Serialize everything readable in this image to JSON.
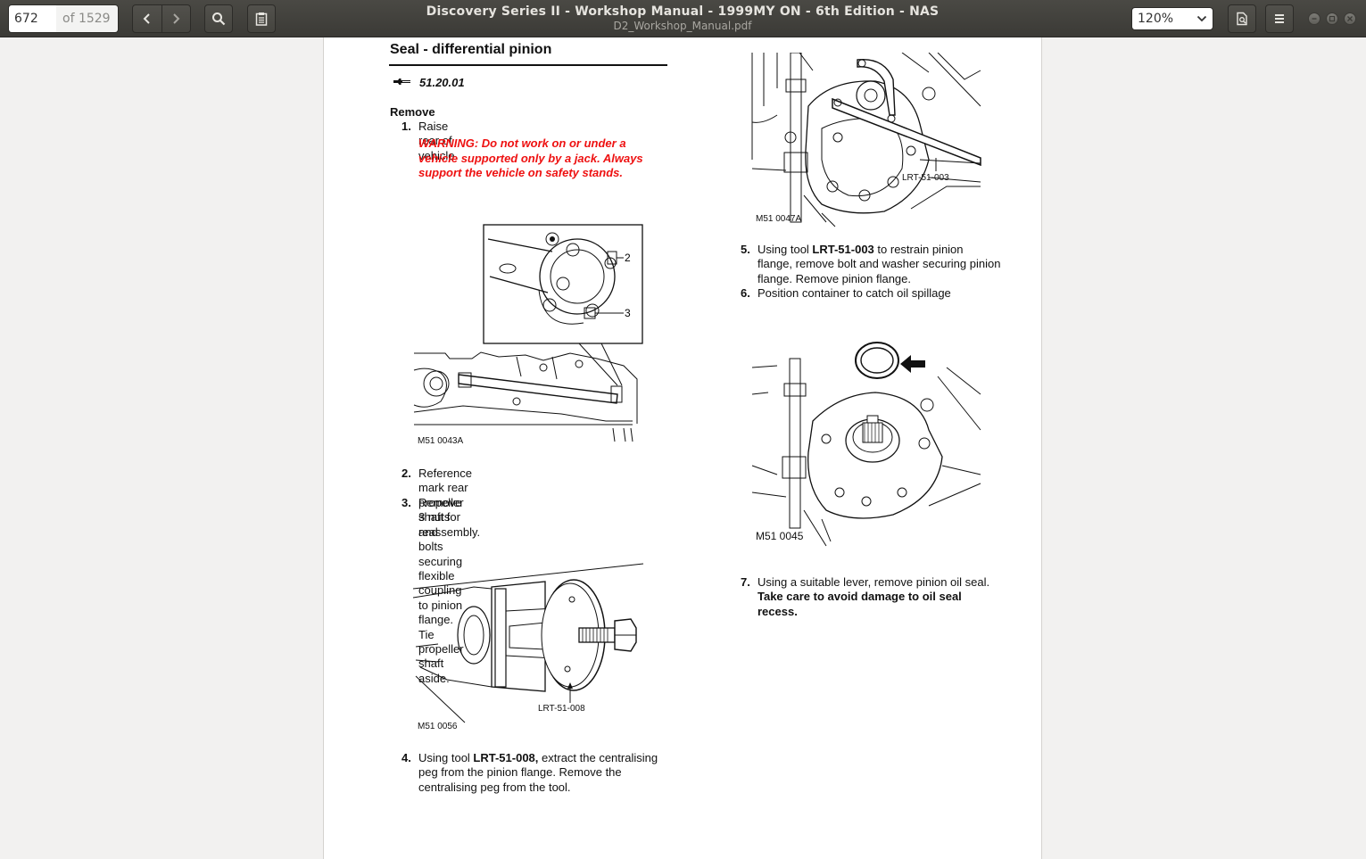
{
  "toolbar": {
    "page_number": "672",
    "page_total": "of 1529",
    "title": "Discovery Series II - Workshop Manual - 1999MY ON - 6th Edition - NAS",
    "filename": "D2_Workshop_Manual.pdf",
    "zoom": "120%",
    "icons": [
      "chevron-left-icon",
      "chevron-right-icon",
      "search-icon",
      "clipboard-icon",
      "document-properties-icon",
      "menu-icon",
      "minimize-icon",
      "maximize-icon",
      "close-icon"
    ]
  },
  "doc": {
    "section_title": "Seal - differential pinion",
    "op_code": "51.20.01",
    "heading_remove": "Remove",
    "step1_num": "1.",
    "step1_text": "Raise rear of vehicle.",
    "warning_lines": [
      "WARNING: Do not work on or under a",
      "vehicle supported only by a jack. Always",
      "support the vehicle on safety stands."
    ],
    "fig1_callout_2": "2",
    "fig1_callout_3": "3",
    "fig1_code": "M51 0043A",
    "step2_num": "2.",
    "step2_lines": [
      "Reference mark rear propeller shaft for",
      "reassembly."
    ],
    "step3_num": "3.",
    "step3_lines": [
      "Remove  3 nuts and bolts securing flexible",
      "coupling to pinion flange. Tie propeller shaft",
      "aside."
    ],
    "fig2_tool": "LRT-51-008",
    "fig2_code": "M51 0056",
    "step4_num": "4.",
    "step4_pre": "Using tool ",
    "step4_tool": "LRT-51-008,",
    "step4_post": " extract the centralising",
    "step4_lines": [
      "peg from the pinion flange. Remove the",
      "centralising peg from the tool."
    ],
    "fig3_tool": "LRT-51-003",
    "fig3_code": "M51 0047A",
    "step5_num": "5.",
    "step5_pre": "Using tool ",
    "step5_tool": "LRT-51-003",
    "step5_post": "  to restrain  pinion",
    "step5_lines": [
      "flange, remove bolt and washer securing pinion",
      "flange. Remove pinion flange."
    ],
    "step6_num": "6.",
    "step6_text": "Position container to catch oil spillage",
    "fig4_code": "M51 0045",
    "step7_num": "7.",
    "step7_text": "Using a suitable lever, remove pinion oil seal.",
    "step7_bold_lines": [
      "Take care to avoid damage to oil seal",
      "recess."
    ]
  }
}
